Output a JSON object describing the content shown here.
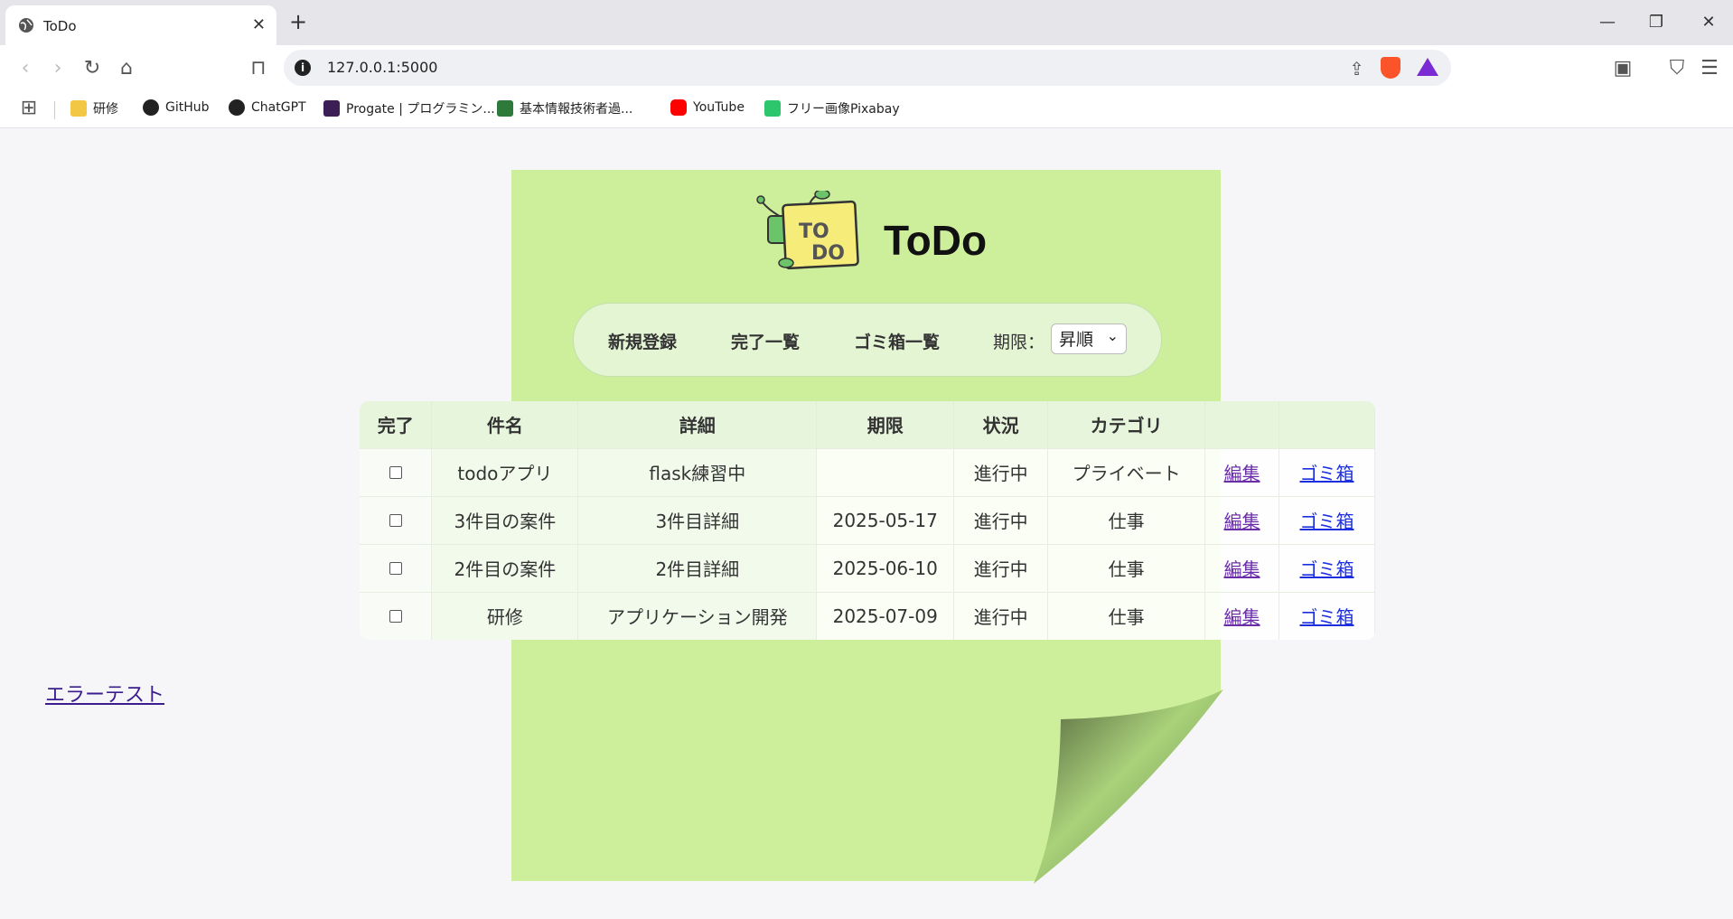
{
  "browser": {
    "tab_title": "ToDo",
    "new_tab": "+",
    "url": "127.0.0.1:5000",
    "bookmarks": [
      {
        "label": "研修"
      },
      {
        "label": "GitHub"
      },
      {
        "label": "ChatGPT"
      },
      {
        "label": "Progate | プログラミン..."
      },
      {
        "label": "基本情報技術者過..."
      },
      {
        "label": "YouTube"
      },
      {
        "label": "フリー画像Pixabay"
      }
    ]
  },
  "app": {
    "title": "ToDo",
    "logo_text_1": "TO",
    "logo_text_2": "DO"
  },
  "menu": {
    "new": "新規登録",
    "completed": "完了一覧",
    "trash": "ゴミ箱一覧",
    "sort_label": "期限：",
    "sort_value": "昇順"
  },
  "table": {
    "headers": [
      "完了",
      "件名",
      "詳細",
      "期限",
      "状況",
      "カテゴリ",
      "",
      ""
    ],
    "rows": [
      {
        "title": "todoアプリ",
        "detail": "flask練習中",
        "due": "",
        "status": "進行中",
        "category": "プライベート",
        "edit": "編集",
        "trash": "ゴミ箱"
      },
      {
        "title": "3件目の案件",
        "detail": "3件目詳細",
        "due": "2025-05-17",
        "status": "進行中",
        "category": "仕事",
        "edit": "編集",
        "trash": "ゴミ箱"
      },
      {
        "title": "2件目の案件",
        "detail": "2件目詳細",
        "due": "2025-06-10",
        "status": "進行中",
        "category": "仕事",
        "edit": "編集",
        "trash": "ゴミ箱"
      },
      {
        "title": "研修",
        "detail": "アプリケーション開発",
        "due": "2025-07-09",
        "status": "進行中",
        "category": "仕事",
        "edit": "編集",
        "trash": "ゴミ箱"
      }
    ]
  },
  "error_link": "エラーテスト",
  "colors": {
    "note": "#cdee9a",
    "menu_bg": "#e4f5d4",
    "edit_link": "#6a2fa8",
    "trash_link": "#1b2fe0"
  }
}
